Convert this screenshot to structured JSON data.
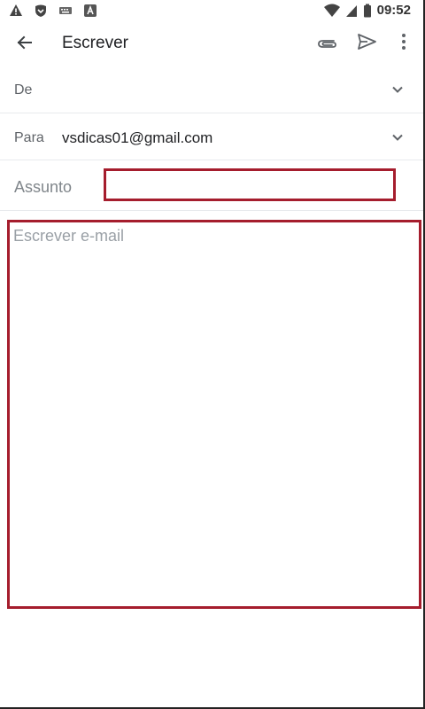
{
  "status_bar": {
    "time": "09:52",
    "left_icons": [
      "warning-icon",
      "shield-icon",
      "keyboard-icon",
      "font-icon"
    ],
    "right_icons": [
      "wifi-icon",
      "signal-icon",
      "battery-icon"
    ]
  },
  "app_bar": {
    "title": "Escrever",
    "icons": [
      "back-arrow-icon",
      "attachment-icon",
      "send-icon",
      "more-vert-icon"
    ]
  },
  "form": {
    "from_label": "De",
    "to_label": "Para",
    "to_value": "vsdicas01@gmail.com",
    "subject_label": "Assunto",
    "subject_value": "",
    "body_placeholder": "Escrever e-mail"
  },
  "colors": {
    "highlight_border": "#a51d2d",
    "label": "#5f6368",
    "placeholder": "#9aa0a6"
  }
}
